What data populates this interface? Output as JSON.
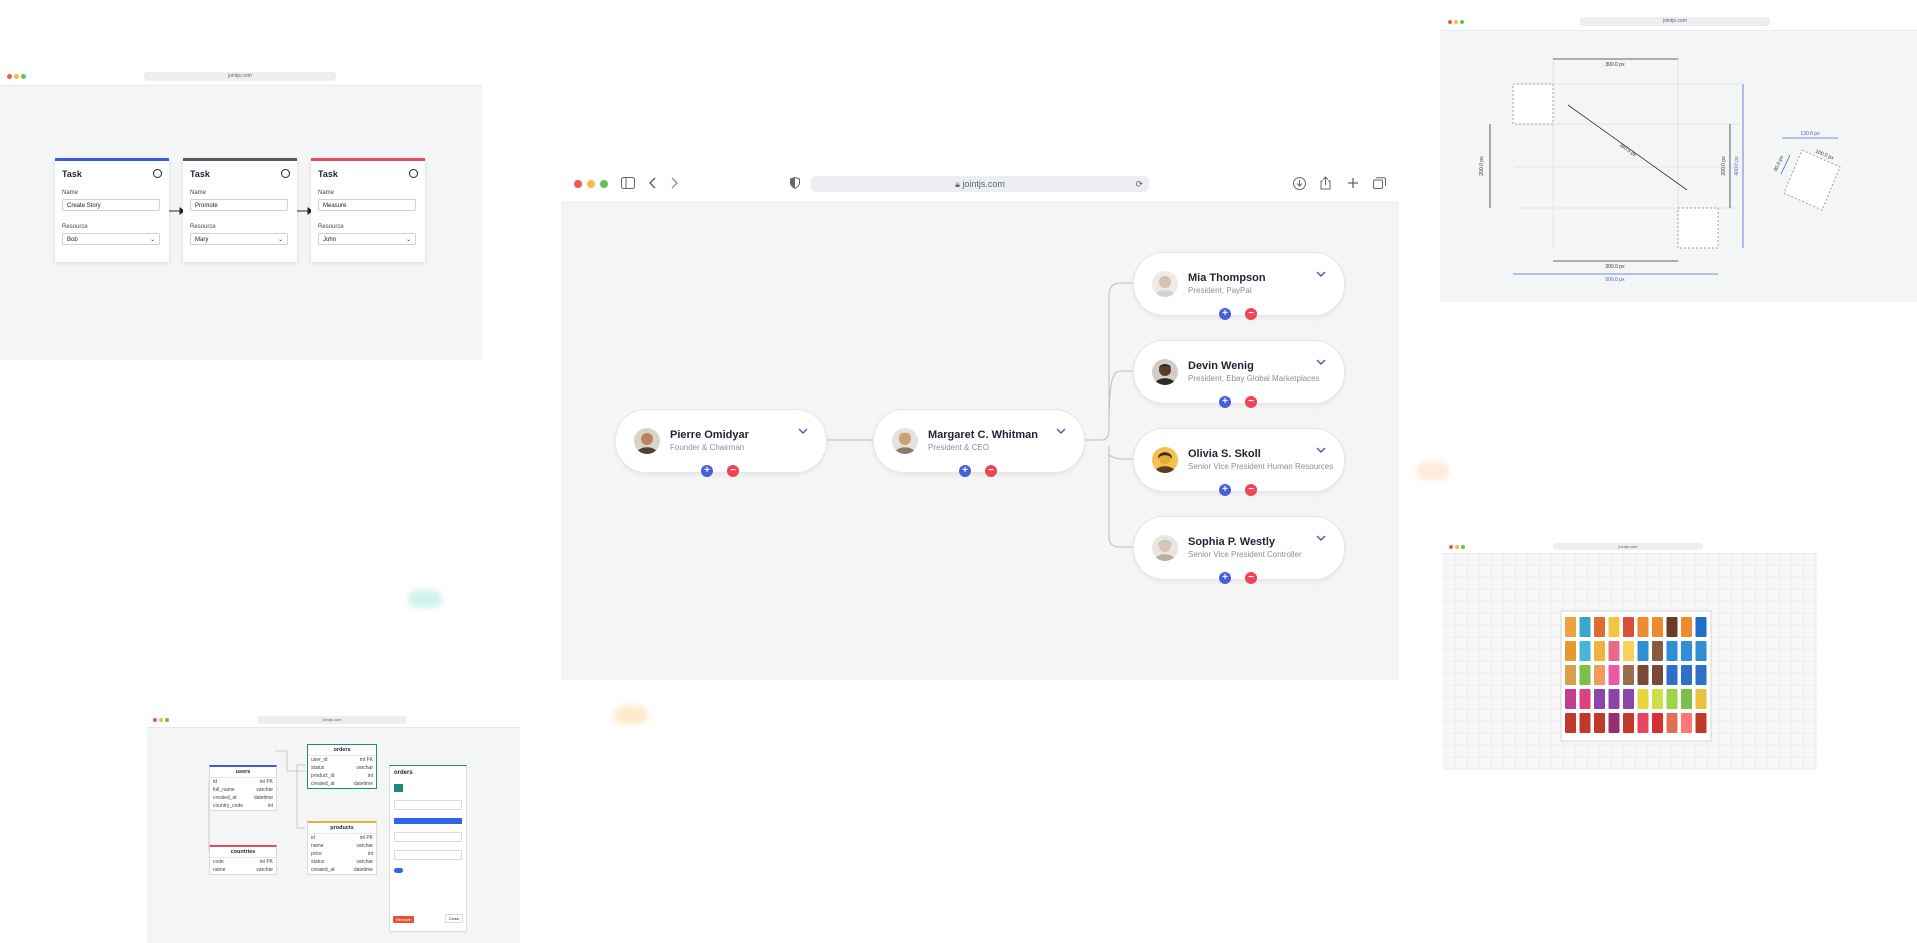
{
  "main_window": {
    "url": "jointjs.com",
    "org_chart": {
      "nodes": [
        {
          "id": "pierre",
          "name": "Pierre Omidyar",
          "title": "Founder & Chairman",
          "avatar_color": "#b9835f"
        },
        {
          "id": "margaret",
          "name": "Margaret C. Whitman",
          "title": "President & CEO",
          "avatar_color": "#c9a27a"
        },
        {
          "id": "mia",
          "name": "Mia Thompson",
          "title": "President, PayPal",
          "avatar_color": "#d8c0b0"
        },
        {
          "id": "devin",
          "name": "Devin Wenig",
          "title": "President, Ebay Global Marketplaces",
          "avatar_color": "#5a3b2e"
        },
        {
          "id": "olivia",
          "name": "Olivia S. Skoll",
          "title": "Senior Vice President Human Resources",
          "avatar_color": "#e0a93a"
        },
        {
          "id": "sophia",
          "name": "Sophia P. Westly",
          "title": "Senior Vice President Controller",
          "avatar_color": "#c8c4bc"
        }
      ],
      "add_label": "+",
      "remove_label": "−"
    }
  },
  "task_window": {
    "url": "jointjs.com",
    "cards": [
      {
        "header": "Task",
        "header_color": "#3b5bdb",
        "name_label": "Name",
        "name_value": "Create Story",
        "resource_label": "Resource",
        "resource_value": "Bob",
        "icon": "check-circle-icon"
      },
      {
        "header": "Task",
        "header_color": "#555a61",
        "name_label": "Name",
        "name_value": "Promote",
        "resource_label": "Resource",
        "resource_value": "Mary",
        "icon": "clock-icon"
      },
      {
        "header": "Task",
        "header_color": "#e64a5e",
        "name_label": "Name",
        "name_value": "Measure",
        "resource_label": "Resource",
        "resource_value": "John",
        "icon": "alert-circle-icon"
      }
    ]
  },
  "measure_window": {
    "url": "jointjs.com",
    "measurements": {
      "top_width": "300.0 px",
      "diagonal": "360.5 px",
      "left_height": "200.0 px",
      "right_height": "200.0 px",
      "right_outer_height": "400.0 px",
      "bottom_width": "300.0 px",
      "bottom_outer_width": "500.0 px",
      "rotated_top": "130.6 px",
      "rotated_side": "100.0 px",
      "rotated_left": "90.0 px"
    }
  },
  "erd_window": {
    "url": "jointjs.com",
    "tables": {
      "users": {
        "title": "users",
        "color": "#3b5bdb",
        "rows": [
          [
            "id",
            "int PK"
          ],
          [
            "full_name",
            "varchar"
          ],
          [
            "created_at",
            "datetime"
          ],
          [
            "country_code",
            "int"
          ]
        ]
      },
      "orders": {
        "title": "orders",
        "color": "#1f8a7a",
        "rows": [
          [
            "user_id",
            "int FK"
          ],
          [
            "status",
            "varchar"
          ],
          [
            "product_id",
            "int"
          ],
          [
            "created_at",
            "datetime"
          ]
        ]
      },
      "countries": {
        "title": "countries",
        "color": "#e64a5e",
        "rows": [
          [
            "code",
            "int PK"
          ],
          [
            "name",
            "varchar"
          ]
        ]
      },
      "products": {
        "title": "products",
        "color": "#e3b23c",
        "rows": [
          [
            "id",
            "int PK"
          ],
          [
            "name",
            "varchar"
          ],
          [
            "price",
            "int"
          ],
          [
            "status",
            "varchar"
          ],
          [
            "created_at",
            "datetime"
          ]
        ]
      }
    },
    "inspector": {
      "title": "orders",
      "remove_label": "Remove",
      "close_label": "Close"
    }
  },
  "shelf_window": {
    "url": "jointjs.com"
  }
}
